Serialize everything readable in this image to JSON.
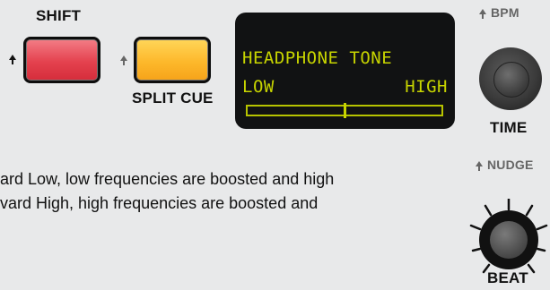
{
  "controls": {
    "shift_label": "SHIFT",
    "split_cue_label": "SPLIT CUE",
    "bpm_label": "BPM",
    "time_label": "TIME",
    "nudge_label": "NUDGE",
    "beat_label": "BEAT"
  },
  "display": {
    "title": "HEADPHONE TONE",
    "low_label": "LOW",
    "high_label": "HIGH",
    "tone_position": 0.5
  },
  "body": {
    "line1": "ard Low, low frequencies are boosted and high",
    "line2": "vard High, high frequencies are boosted and"
  },
  "colors": {
    "shift_button": "#e4414e",
    "split_cue_button": "#fdb82b",
    "lcd_text": "#c7d400",
    "display_bg": "#111213",
    "page_bg": "#e8e9ea"
  },
  "icons": {
    "shift_arrow": "up-arrow-icon",
    "split_arrow": "up-arrow-icon",
    "bpm_arrow": "up-arrow-icon",
    "nudge_arrow": "up-arrow-icon"
  }
}
